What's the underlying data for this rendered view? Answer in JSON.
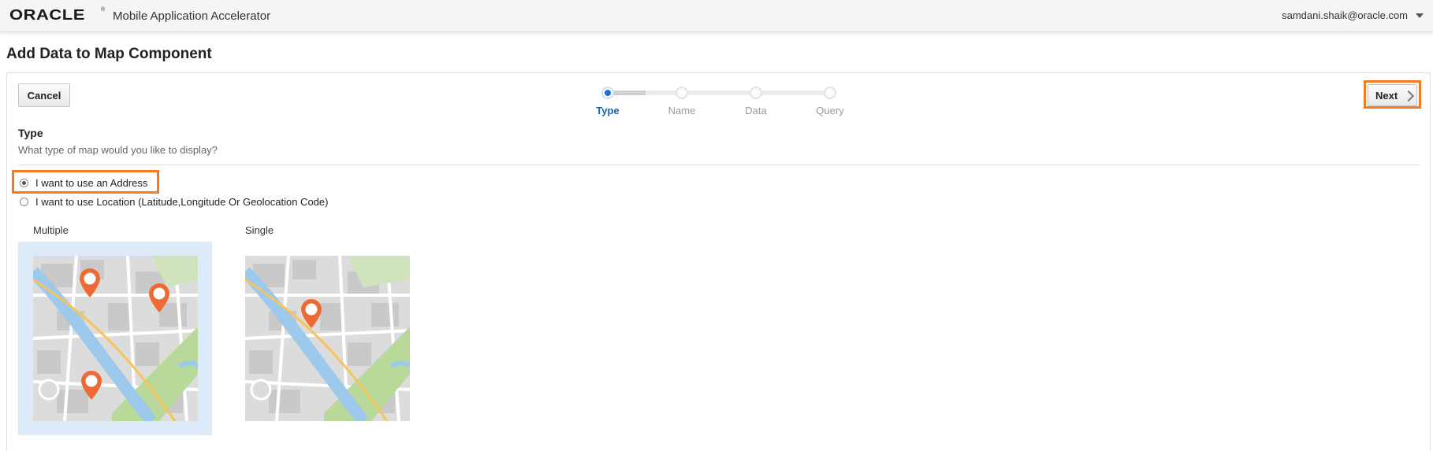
{
  "header": {
    "logo": "ORACLE",
    "logo_mark": "®",
    "app_title": "Mobile Application Accelerator",
    "user": "samdani.shaik@oracle.com",
    "user_menu_icon": "caret-down-icon"
  },
  "page": {
    "title": "Add Data to Map Component"
  },
  "toolbar": {
    "cancel_label": "Cancel",
    "next_label": "Next",
    "next_icon": "chevron-right-icon"
  },
  "stepper": {
    "steps": [
      {
        "label": "Type",
        "state": "active"
      },
      {
        "label": "Name",
        "state": "pending"
      },
      {
        "label": "Data",
        "state": "pending"
      },
      {
        "label": "Query",
        "state": "pending"
      }
    ],
    "active_color": "#1a73c8"
  },
  "type_section": {
    "title": "Type",
    "description": "What type of map would you like to display?",
    "options": [
      {
        "label": "I want to use an Address",
        "checked": true
      },
      {
        "label": "I want to use Location (Latitude,Longitude Or Geolocation Code)",
        "checked": false
      }
    ]
  },
  "map_options": [
    {
      "label": "Multiple",
      "selected": true,
      "pins": 3
    },
    {
      "label": "Single",
      "selected": false,
      "pins": 1
    }
  ],
  "colors": {
    "highlight": "#f47b20",
    "pin": "#ee6a35",
    "selected_bg": "#ddebf8"
  }
}
